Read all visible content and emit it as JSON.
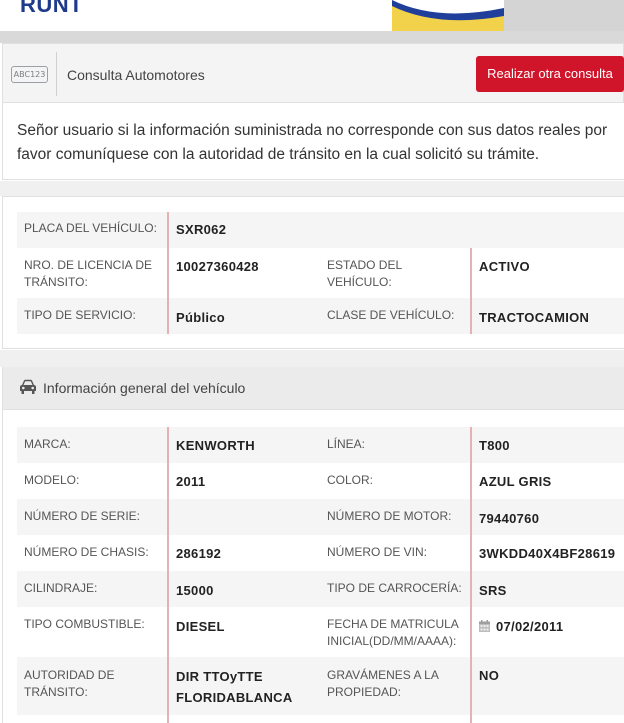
{
  "banner": {
    "logo_text": "RUNT"
  },
  "header": {
    "badge": "ABC123",
    "title": "Consulta Automotores",
    "button_label": "Realizar otra consulta"
  },
  "notice": "Señor usuario si la información suministrada no corresponde con sus datos reales por favor comuníquese con la autoridad de tránsito en la cual solicitó su trámite.",
  "summary": {
    "placa_label": "PLACA DEL VEHÍCULO:",
    "placa_value": "SXR062",
    "licencia_label": "NRO. DE LICENCIA DE TRÁNSITO:",
    "licencia_value": "10027360428",
    "estado_label": "ESTADO DEL VEHÍCULO:",
    "estado_value": "ACTIVO",
    "servicio_label": "TIPO DE SERVICIO:",
    "servicio_value": "Público",
    "clase_label": "CLASE DE VEHÍCULO:",
    "clase_value": "TRACTOCAMION"
  },
  "general": {
    "section_title": "Información general del vehículo",
    "marca_label": "MARCA:",
    "marca_value": "KENWORTH",
    "linea_label": "LÍNEA:",
    "linea_value": "T800",
    "modelo_label": "MODELO:",
    "modelo_value": "2011",
    "color_label": "COLOR:",
    "color_value": "AZUL GRIS",
    "serie_label": "NÚMERO DE SERIE:",
    "serie_value": "",
    "motor_label": "NÚMERO DE MOTOR:",
    "motor_value": "79440760",
    "chasis_label": "NÚMERO DE CHASIS:",
    "chasis_value": "286192",
    "vin_label": "NÚMERO DE VIN:",
    "vin_value": "3WKDD40X4BF28619",
    "cilindraje_label": "CILINDRAJE:",
    "cilindraje_value": "15000",
    "carroceria_label": "TIPO DE CARROCERÍA:",
    "carroceria_value": "SRS",
    "combustible_label": "TIPO COMBUSTIBLE:",
    "combustible_value": "DIESEL",
    "matricula_label": "FECHA DE MATRICULA INICIAL(DD/MM/AAAA):",
    "matricula_value": "07/02/2011",
    "autoridad_label": "AUTORIDAD DE TRÁNSITO:",
    "autoridad_value": "DIR TTOyTTE FLORIDABLANCA",
    "gravamenes_label": "GRAVÁMENES A LA PROPIEDAD:",
    "gravamenes_value": "NO"
  },
  "colors": {
    "accent": "#d0152b",
    "divider": "#e5b2b4",
    "brand_blue": "#1e3a8a"
  },
  "icons": {
    "badge": "license-plate-icon",
    "section": "car-icon",
    "date": "calendar-icon"
  }
}
